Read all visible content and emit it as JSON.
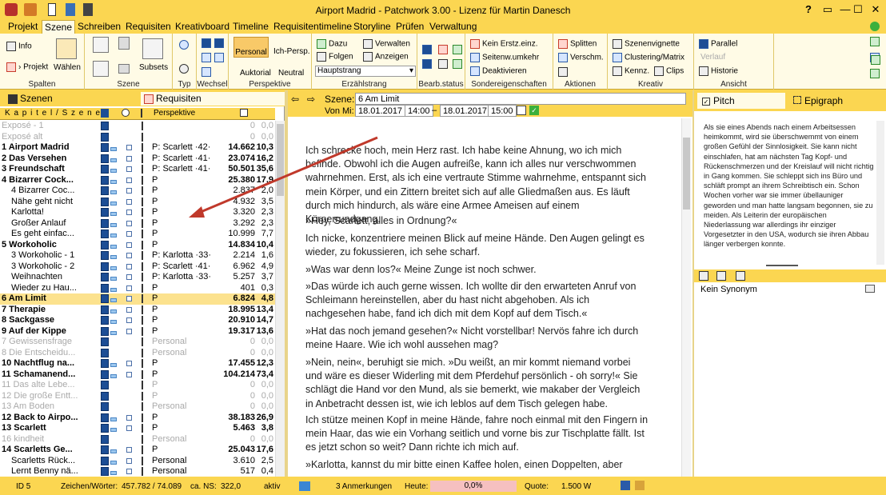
{
  "window": {
    "title": "Airport Madrid  -  Patchwork 3.00  -  Lizenz für Martin Danesch",
    "help": "?"
  },
  "menu": [
    "Projekt",
    "Szene",
    "Schreiben",
    "Requisiten",
    "Kreativboard",
    "Timeline",
    "Requisitentimeline",
    "Storyline",
    "Prüfen",
    "Verwaltung"
  ],
  "ribbon": {
    "spalten": {
      "info": "Info",
      "projekt": "› Projekt",
      "waehlen": "Wählen",
      "label": "Spalten"
    },
    "szene": {
      "subsets": "Subsets",
      "label": "Szene"
    },
    "typ": {
      "label": "Typ"
    },
    "wechsel": {
      "label": "Wechsel"
    },
    "perspektive": {
      "personal": "Personal",
      "ichpersp": "Ich-Persp.",
      "auktorial": "Auktorial",
      "neutral": "Neutral",
      "label": "Perspektive"
    },
    "erzaehlstrang": {
      "dazu": "Dazu",
      "folgen": "Folgen",
      "verwalten": "Verwalten",
      "anzeigen": "Anzeigen",
      "select": "Hauptstrang",
      "label": "Erzählstrang"
    },
    "bearb": {
      "label": "Bearb.status"
    },
    "sonder": {
      "kein": "Kein Erstz.einz.",
      "seiten": "Seitenw.umkehr",
      "deakt": "Deaktivieren",
      "label": "Sondereigenschaften"
    },
    "aktionen": {
      "split": "Splitten",
      "verschm": "Verschm.",
      "label": "Aktionen"
    },
    "kreativ": {
      "vign": "Szenenvignette",
      "clust": "Clustering/Matrix",
      "kennz": "Kennz.",
      "clips": "Clips",
      "label": "Kreativ"
    },
    "ansicht": {
      "parallel": "Parallel",
      "verlauf": "Verlauf",
      "historie": "Historie",
      "label": "Ansicht"
    }
  },
  "left": {
    "tabs": {
      "szenen": "Szenen",
      "requisiten": "Requisiten"
    },
    "header": {
      "name": "K a p i t e l  /  S z e n e",
      "persp": "Perspektive"
    },
    "rows": [
      {
        "n": "Exposé - 1",
        "p": "",
        "w": "0",
        "pc": "0,0",
        "g": true
      },
      {
        "n": "Exposé alt",
        "p": "",
        "w": "0",
        "pc": "0,0",
        "g": true
      },
      {
        "n": "1 Airport Madrid",
        "p": "P: Scarlett ·42·",
        "w": "14.662",
        "pc": "10,3",
        "b": true
      },
      {
        "n": "2 Das Versehen",
        "p": "P: Scarlett ·41·",
        "w": "23.074",
        "pc": "16,2",
        "b": true
      },
      {
        "n": "3 Freundschaft",
        "p": "P: Scarlett ·41·",
        "w": "50.501",
        "pc": "35,6",
        "b": true
      },
      {
        "n": "4 Bizarrer Cock...",
        "p": "P",
        "w": "25.380",
        "pc": "17,9",
        "b": true
      },
      {
        "n": "4 Bizarrer Coc...",
        "p": "P",
        "w": "2.837",
        "pc": "2,0"
      },
      {
        "n": "Nähe geht nicht",
        "p": "P",
        "w": "4.932",
        "pc": "3,5"
      },
      {
        "n": "Karlotta!",
        "p": "P",
        "w": "3.320",
        "pc": "2,3"
      },
      {
        "n": "Großer Anlauf",
        "p": "P",
        "w": "3.292",
        "pc": "2,3"
      },
      {
        "n": "Es geht einfac...",
        "p": "P",
        "w": "10.999",
        "pc": "7,7"
      },
      {
        "n": "5 Workoholic",
        "p": "P",
        "w": "14.834",
        "pc": "10,4",
        "b": true
      },
      {
        "n": "3 Workoholic - 1",
        "p": "P: Karlotta ·33·",
        "w": "2.214",
        "pc": "1,6"
      },
      {
        "n": "3 Workoholic - 2",
        "p": "P: Scarlett ·41·",
        "w": "6.962",
        "pc": "4,9"
      },
      {
        "n": "Weihnachten",
        "p": "P: Karlotta ·33·",
        "w": "5.257",
        "pc": "3,7"
      },
      {
        "n": "Wieder zu Hau...",
        "p": "P",
        "w": "401",
        "pc": "0,3"
      },
      {
        "n": "6 Am Limit",
        "p": "P",
        "w": "6.824",
        "pc": "4,8",
        "b": true,
        "sel": true
      },
      {
        "n": "7 Therapie",
        "p": "P",
        "w": "18.995",
        "pc": "13,4",
        "b": true
      },
      {
        "n": "8 Sackgasse",
        "p": "P",
        "w": "20.910",
        "pc": "14,7",
        "b": true
      },
      {
        "n": "9 Auf der Kippe",
        "p": "P",
        "w": "19.317",
        "pc": "13,6",
        "b": true
      },
      {
        "n": "7 Gewissensfrage",
        "p": "Personal",
        "w": "0",
        "pc": "0,0",
        "g": true
      },
      {
        "n": "8 Die Entscheidu...",
        "p": "Personal",
        "w": "0",
        "pc": "0,0",
        "g": true
      },
      {
        "n": "10 Nachtflug na...",
        "p": "P",
        "w": "17.455",
        "pc": "12,3",
        "b": true
      },
      {
        "n": "11 Schamanend...",
        "p": "P",
        "w": "104.214",
        "pc": "73,4",
        "b": true
      },
      {
        "n": "11 Das alte Lebe...",
        "p": "P",
        "w": "0",
        "pc": "0,0",
        "g": true
      },
      {
        "n": "12 Die große Entt...",
        "p": "P",
        "w": "0",
        "pc": "0,0",
        "g": true
      },
      {
        "n": "13 Am Boden",
        "p": "Personal",
        "w": "0",
        "pc": "0,0",
        "g": true
      },
      {
        "n": "12 Back to Airpo...",
        "p": "P",
        "w": "38.183",
        "pc": "26,9",
        "b": true
      },
      {
        "n": "13 Scarlett",
        "p": "P",
        "w": "5.463",
        "pc": "3,8",
        "b": true
      },
      {
        "n": "16 kindheit",
        "p": "Personal",
        "w": "0",
        "pc": "0,0",
        "g": true
      },
      {
        "n": "14 Scarletts Ge...",
        "p": "P",
        "w": "25.043",
        "pc": "17,6",
        "b": true
      },
      {
        "n": "Scarletts Rück...",
        "p": "Personal",
        "w": "3.610",
        "pc": "2,5"
      },
      {
        "n": "Lernt Benny nä...",
        "p": "Personal",
        "w": "517",
        "pc": "0,4"
      }
    ]
  },
  "center": {
    "szene_label": "Szene:",
    "szene_value": "6 Am Limit",
    "vonmi": "Von Mi:",
    "d1": "18.01.2017",
    "t1": "14:00",
    "dash": "–",
    "d2": "18.01.2017",
    "t2": "15:00",
    "paragraphs": [
      "Ich schrecke hoch, mein Herz rast. Ich habe keine Ahnung, wo ich mich befinde. Obwohl ich die Augen aufreiße, kann ich alles nur verschwommen wahrnehmen. Erst, als ich eine vertraute Stimme wahrnehme, entspannt sich mein Körper, und ein Zittern breitet sich auf alle Gliedmaßen aus. Es läuft durch mich hindurch, als wäre eine Armee Ameisen auf einem Körperrundgang.",
      "»Hey, Scarlett, alles in Ordnung?«",
      "Ich nicke, konzentriere meinen Blick auf meine Hände. Den Augen gelingt es wieder, zu fokussieren, ich sehe scharf.",
      "»Was war denn los?« Meine Zunge ist noch schwer.",
      "»Das würde ich auch gerne wissen. Ich wollte dir den erwarteten Anruf von Schleimann hereinstellen, aber du hast nicht abgehoben. Als ich nachgesehen habe, fand ich dich mit dem Kopf auf dem Tisch.«",
      "»Hat das noch jemand gesehen?« Nicht vorstellbar! Nervös fahre ich durch meine Haare. Wie ich wohl aussehen mag?",
      "»Nein, nein«, beruhigt sie mich. »Du weißt, an mir kommt niemand vorbei und wäre es dieser Widerling mit dem Pferdehuf persönlich - oh sorry!« Sie schlägt die Hand vor den Mund, als sie bemerkt, wie makaber der Vergleich in Anbetracht dessen ist, wie ich leblos auf dem Tisch gelegen habe.",
      "Ich stütze meinen Kopf in meine Hände, fahre noch einmal mit den Fingern in mein Haar, das wie ein Vorhang seitlich und vorne bis zur Tischplatte fällt. Ist es jetzt schon so weit? Dann richte ich mich auf.",
      "»Karlotta, kannst du mir bitte einen Kaffee holen, einen Doppelten, aber"
    ]
  },
  "right": {
    "pitch": "Pitch",
    "epigraph": "Epigraph",
    "epi_text": "Als sie eines Abends nach einem Arbeitsessen heimkommt, wird sie überschwemmt von einem großen Gefühl der Sinnlosigkeit. Sie kann nicht einschlafen, hat am nächsten Tag Kopf- und Rückenschmerzen und der Kreislauf will nicht richtig in Gang kommen. Sie schleppt sich ins Büro und schläft prompt an ihrem Schreibtisch ein. Schon Wochen vorher war sie immer übellauniger geworden und man hatte langsam begonnen, sie zu meiden. Als Leiterin der europäischen Niederlassung war allerdings ihr einziger Vorgesetzter in den USA, wodurch sie ihren Abbau länger verbergen konnte.",
    "syn": "Kein Synonym"
  },
  "status": {
    "id": "ID 5",
    "zw_label": "Zeichen/Wörter:",
    "zw": "457.782 / 74.089",
    "ns_label": "ca. NS:",
    "ns": "322,0",
    "aktiv": "aktiv",
    "anm": "3 Anmerkungen",
    "heute_label": "Heute:",
    "heute": "0,0%",
    "quote_label": "Quote:",
    "quote": "1.500 W"
  },
  "colors": {
    "accent": "#fbd651",
    "ribbon": "#fffbe6",
    "selected_row": "#fce28e",
    "arrow": "#c0392b"
  }
}
